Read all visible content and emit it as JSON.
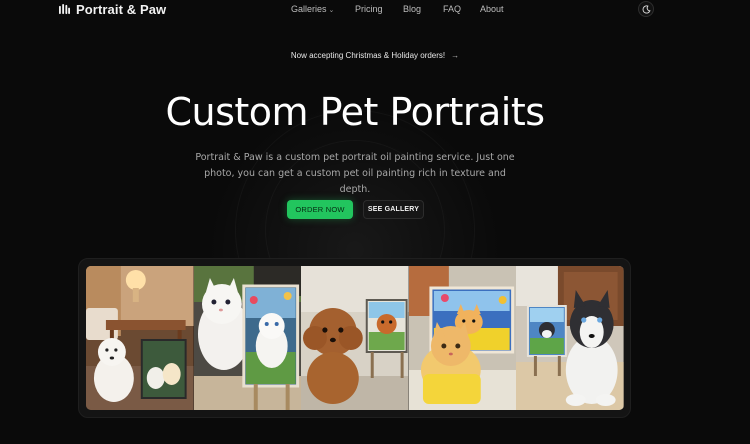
{
  "header": {
    "brand": "Portrait & Paw",
    "nav": {
      "galleries": "Galleries",
      "pricing": "Pricing",
      "blog": "Blog",
      "faq": "FAQ",
      "about": "About"
    },
    "theme_toggle_icon": "moon-icon"
  },
  "announcement": {
    "text": "Now accepting Christmas & Holiday orders!",
    "arrow": "→"
  },
  "hero": {
    "title": "Custom Pet Portraits",
    "subtitle": "Portrait & Paw is a custom pet portrait oil painting service. Just one photo, you can get a custom pet oil painting rich in texture and depth.",
    "primary_button": "ORDER NOW",
    "secondary_button": "SEE GALLERY"
  },
  "showcase": {
    "tiles": [
      "white-dog-living-room-photo",
      "white-persian-cat-with-painting-photo",
      "poodle-with-painting-photo",
      "orange-cat-with-painting-photo",
      "husky-with-painting-photo"
    ]
  },
  "colors": {
    "background": "#0a0a0a",
    "accent": "#22c55e",
    "text": "#ededed",
    "muted": "#a8a8a8"
  }
}
